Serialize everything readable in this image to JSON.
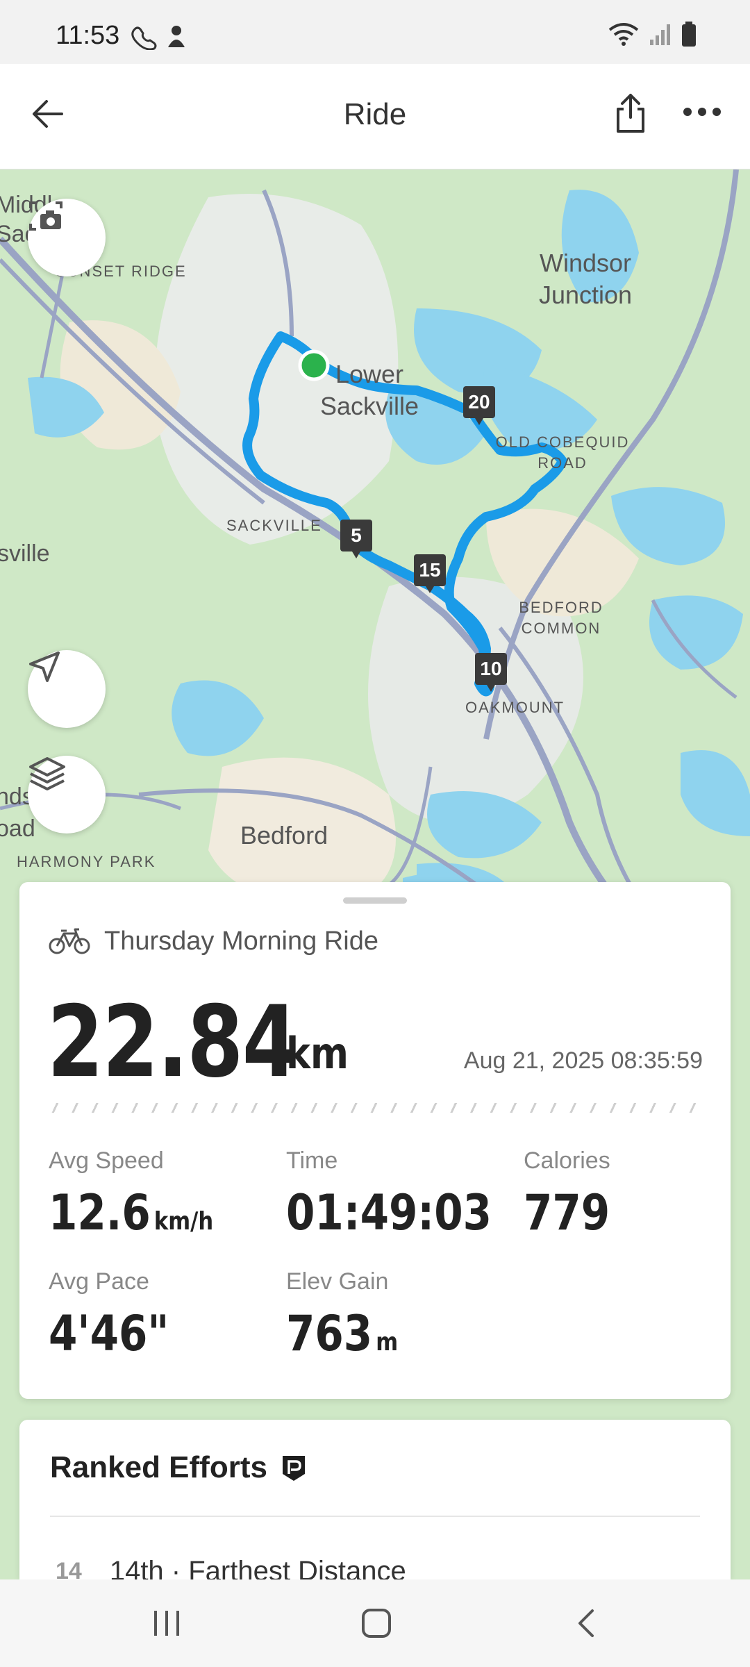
{
  "status_bar": {
    "time": "11:53"
  },
  "header": {
    "title": "Ride"
  },
  "map": {
    "labels": {
      "middle_sackville": "Middle Sackville",
      "sunset_ridge": "SUNSET RIDGE",
      "windsor_junction": "Windsor Junction",
      "lower_sackville": "Lower Sackville",
      "old_cobequid_road": "OLD COBEQUID ROAD",
      "sackville": "SACKVILLE",
      "sville": "sville",
      "bedford_common": "BEDFORD COMMON",
      "oakmount": "OAKMOUNT",
      "bedford": "Bedford",
      "harmony_park": "HARMONY PARK",
      "ends_road": "nds oad"
    },
    "km_markers": [
      "5",
      "10",
      "15",
      "20"
    ]
  },
  "activity": {
    "name": "Thursday Morning Ride",
    "distance": "22.84",
    "distance_unit": "km",
    "datetime": "Aug 21, 2025 08:35:59",
    "stats": {
      "avg_speed": {
        "label": "Avg Speed",
        "value": "12.6",
        "unit": "km/h"
      },
      "time": {
        "label": "Time",
        "value": "01:49:03"
      },
      "calories": {
        "label": "Calories",
        "value": "779"
      },
      "avg_pace": {
        "label": "Avg Pace",
        "value": "4'46\""
      },
      "elev_gain": {
        "label": "Elev Gain",
        "value": "763",
        "unit": "m"
      }
    }
  },
  "ranked_efforts": {
    "title": "Ranked Efforts",
    "items": [
      {
        "rank": "14",
        "text": "14th · Farthest Distance"
      }
    ]
  },
  "colors": {
    "route": "#1a9be8",
    "start_dot": "#2bb24c",
    "water": "#8fd3ee",
    "land": "#cfe8c6"
  }
}
